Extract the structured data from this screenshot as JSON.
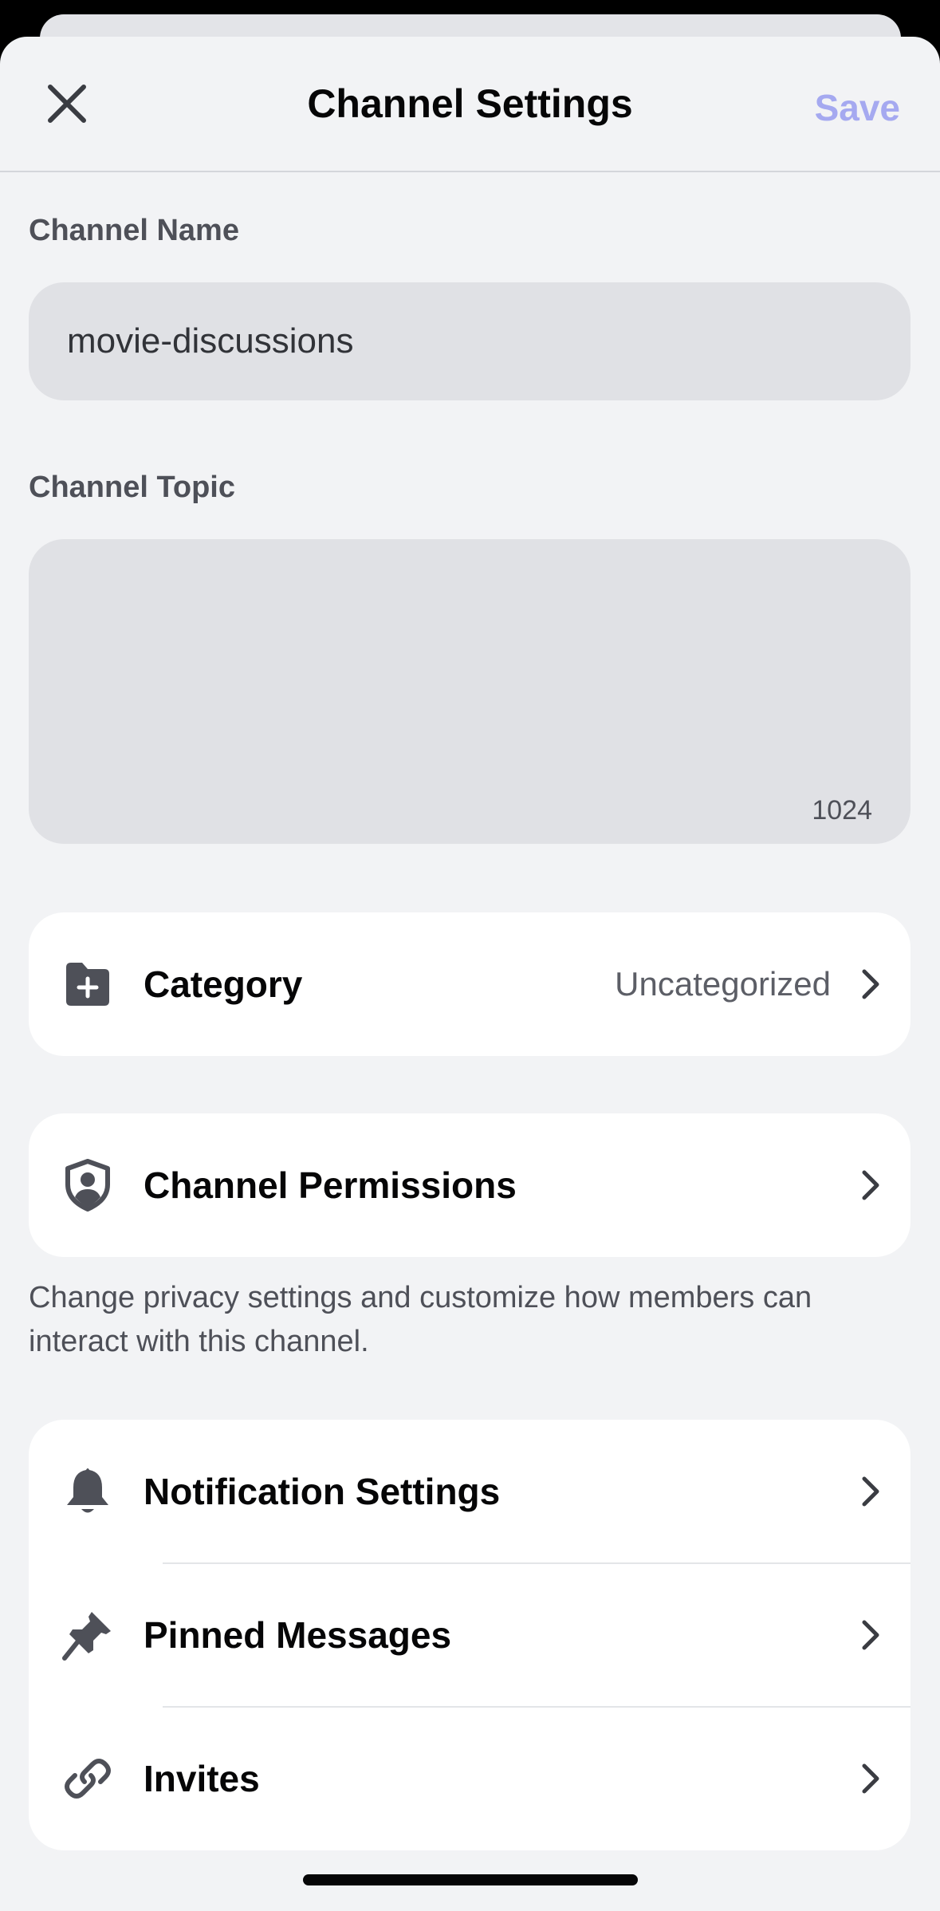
{
  "header": {
    "title": "Channel Settings",
    "save_label": "Save",
    "close_icon": "close-icon"
  },
  "channel_name": {
    "label": "Channel Name",
    "value": "movie-discussions"
  },
  "channel_topic": {
    "label": "Channel Topic",
    "value": "",
    "char_counter": "1024"
  },
  "category": {
    "label": "Category",
    "value": "Uncategorized",
    "icon": "folder-plus-icon"
  },
  "permissions": {
    "label": "Channel Permissions",
    "icon": "shield-user-icon",
    "helper": "Change privacy settings and customize how members can interact with this channel."
  },
  "menu": {
    "items": [
      {
        "label": "Notification Settings",
        "icon": "bell-icon"
      },
      {
        "label": "Pinned Messages",
        "icon": "pin-icon"
      },
      {
        "label": "Invites",
        "icon": "link-icon"
      }
    ]
  },
  "colors": {
    "accent_save_disabled": "#a5a9f0",
    "sheet_bg": "#f2f3f5",
    "card_bg": "#ffffff"
  }
}
